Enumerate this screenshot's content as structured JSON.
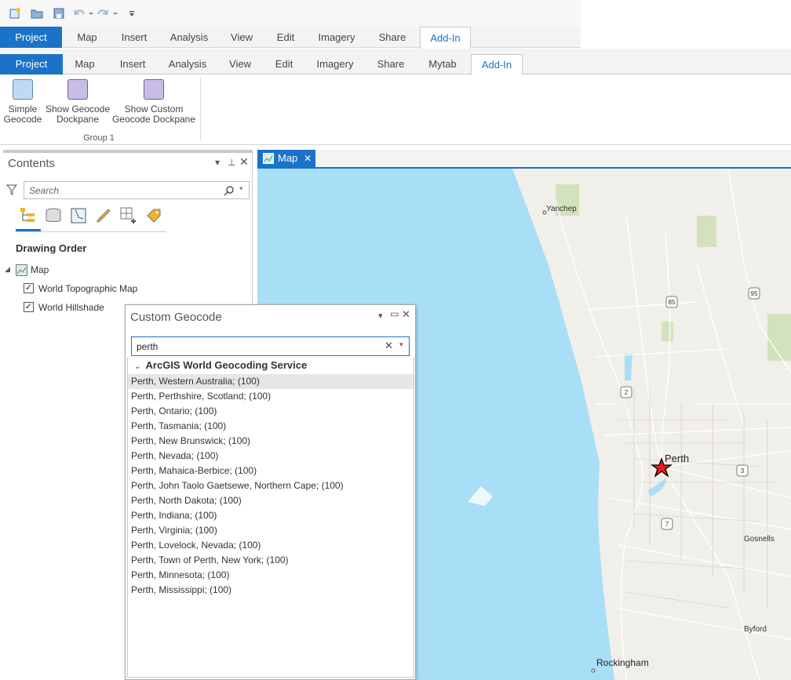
{
  "quick_access": {
    "icons": [
      "new-project-icon",
      "open-project-icon",
      "save-project-icon",
      "undo-icon",
      "redo-icon",
      "customize-qat-icon"
    ]
  },
  "ribbon_top": {
    "tabs": [
      "Project",
      "Map",
      "Insert",
      "Analysis",
      "View",
      "Edit",
      "Imagery",
      "Share",
      "Add-In"
    ]
  },
  "ribbon": {
    "tabs": [
      "Project",
      "Map",
      "Insert",
      "Analysis",
      "View",
      "Edit",
      "Imagery",
      "Share",
      "Mytab",
      "Add-In"
    ],
    "buttons": [
      {
        "line1": "Simple",
        "line2": "Geocode"
      },
      {
        "line1": "Show Geocode",
        "line2": "Dockpane"
      },
      {
        "line1": "Show Custom",
        "line2": "Geocode Dockpane"
      }
    ],
    "group_label": "Group 1"
  },
  "contents": {
    "title": "Contents",
    "search_placeholder": "Search",
    "section_title": "Drawing Order",
    "map_node": "Map",
    "layers": [
      "World Topographic Map",
      "World Hillshade"
    ]
  },
  "map_view": {
    "tab_label": "Map",
    "places": [
      "Yanchep",
      "Perth",
      "Gosnells",
      "Byford",
      "Rockingham"
    ],
    "route_shields": [
      "85",
      "95",
      "2",
      "3",
      "7"
    ],
    "marker_color": "#e81e1e"
  },
  "geocode_pane": {
    "title": "Custom Geocode",
    "query": "perth",
    "group_label": "ArcGIS World Geocoding Service",
    "results": [
      "Perth, Western Australia; (100)",
      "Perth, Perthshire, Scotland; (100)",
      "Perth, Ontario; (100)",
      "Perth, Tasmania; (100)",
      "Perth, New Brunswick; (100)",
      "Perth, Nevada; (100)",
      "Perth, Mahaica-Berbice; (100)",
      "Perth, John Taolo Gaetsewe, Northern Cape; (100)",
      "Perth, North Dakota; (100)",
      "Perth, Indiana; (100)",
      "Perth, Virginia; (100)",
      "Perth, Lovelock, Nevada; (100)",
      "Perth, Town of Perth, New York; (100)",
      "Perth, Minnesota; (100)",
      "Perth, Mississippi; (100)"
    ]
  },
  "colors": {
    "accent": "#1a73c7",
    "water": "#a9def7",
    "land": "#f1efe9"
  }
}
